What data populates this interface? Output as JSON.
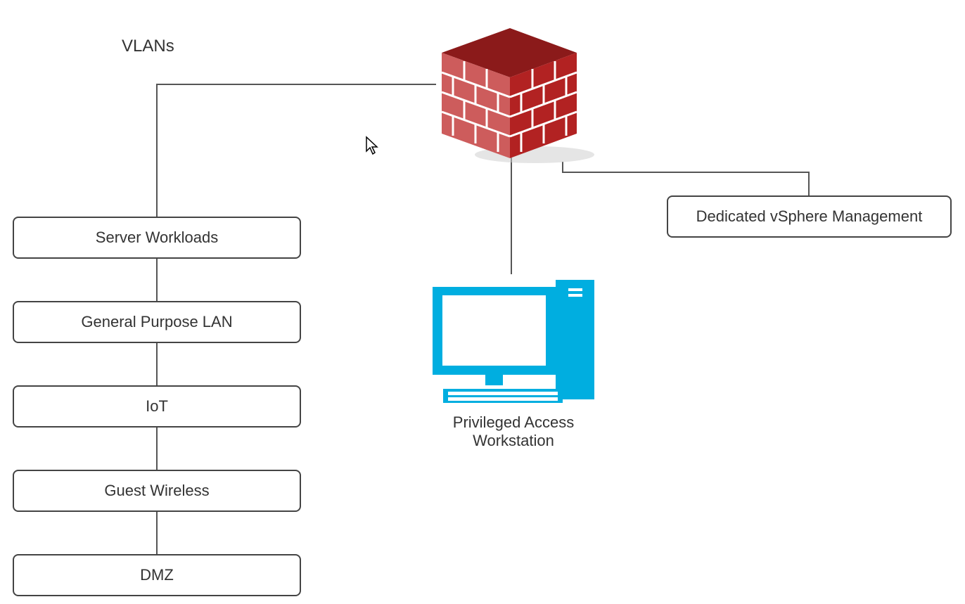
{
  "title": "VLANs",
  "vlan_boxes": [
    {
      "label": "Server Workloads"
    },
    {
      "label": "General Purpose LAN"
    },
    {
      "label": "IoT"
    },
    {
      "label": "Guest Wireless"
    },
    {
      "label": "DMZ"
    }
  ],
  "right_box": {
    "label": "Dedicated vSphere Management"
  },
  "workstation": {
    "line1": "Privileged Access",
    "line2": "Workstation"
  },
  "icons": {
    "firewall": "firewall-icon",
    "workstation": "workstation-icon",
    "cursor": "cursor-icon"
  }
}
